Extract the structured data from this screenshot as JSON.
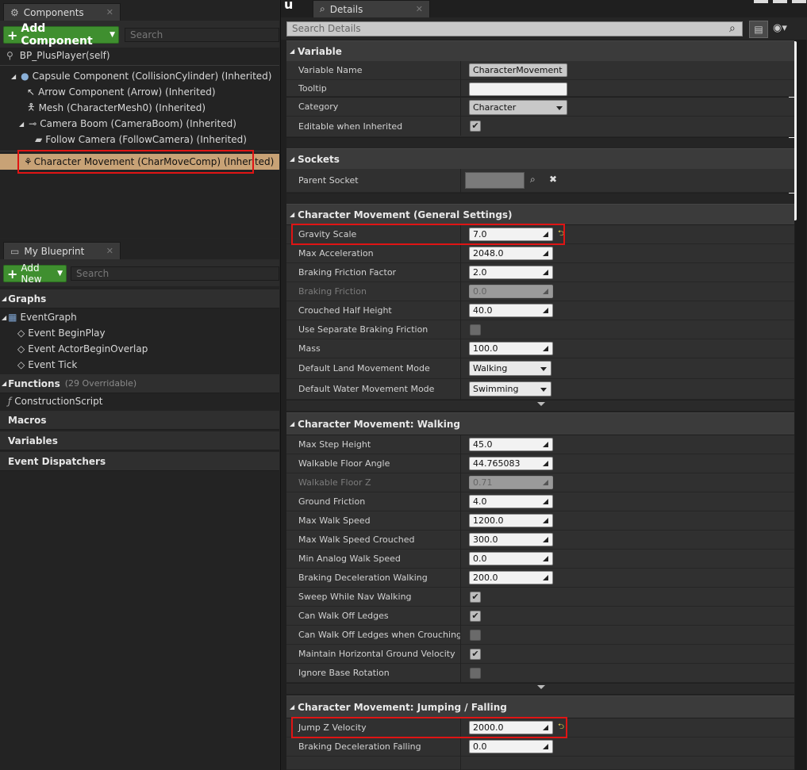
{
  "components": {
    "tab_label": "Components",
    "add_button": "Add Component",
    "search_placeholder": "Search",
    "self_label": "BP_PlusPlayer(self)",
    "tree": [
      {
        "label": "Capsule Component (CollisionCylinder) (Inherited)"
      },
      {
        "label": "Arrow Component (Arrow) (Inherited)"
      },
      {
        "label": "Mesh (CharacterMesh0) (Inherited)"
      },
      {
        "label": "Camera Boom (CameraBoom) (Inherited)"
      },
      {
        "label": "Follow Camera (FollowCamera) (Inherited)"
      }
    ],
    "selected": "Character Movement (CharMoveComp) (Inherited)"
  },
  "my_blueprint": {
    "tab_label": "My Blueprint",
    "add_button": "Add New",
    "search_placeholder": "Search",
    "graphs_label": "Graphs",
    "event_graph": "EventGraph",
    "events": [
      "Event BeginPlay",
      "Event ActorBeginOverlap",
      "Event Tick"
    ],
    "functions_label": "Functions",
    "functions_count": "(29 Overridable)",
    "construction_script": "ConstructionScript",
    "macros": "Macros",
    "variables": "Variables",
    "event_dispatchers": "Event Dispatchers"
  },
  "details": {
    "tab_label": "Details",
    "search_placeholder": "Search Details",
    "variable_section": "Variable",
    "variable_name_label": "Variable Name",
    "variable_name_value": "CharacterMovement",
    "tooltip_label": "Tooltip",
    "tooltip_value": "",
    "category_label": "Category",
    "category_value": "Character",
    "editable_label": "Editable when Inherited",
    "sockets_section": "Sockets",
    "parent_socket_label": "Parent Socket",
    "general_section": "Character Movement (General Settings)",
    "general": [
      {
        "label": "Gravity Scale",
        "value": "7.0"
      },
      {
        "label": "Max Acceleration",
        "value": "2048.0"
      },
      {
        "label": "Braking Friction Factor",
        "value": "2.0"
      },
      {
        "label": "Braking Friction",
        "value": "0.0"
      },
      {
        "label": "Crouched Half Height",
        "value": "40.0"
      },
      {
        "label": "Use Separate Braking Friction",
        "value": ""
      },
      {
        "label": "Mass",
        "value": "100.0"
      },
      {
        "label": "Default Land Movement Mode",
        "value": "Walking"
      },
      {
        "label": "Default Water Movement Mode",
        "value": "Swimming"
      }
    ],
    "walking_section": "Character Movement: Walking",
    "walking": [
      {
        "label": "Max Step Height",
        "value": "45.0"
      },
      {
        "label": "Walkable Floor Angle",
        "value": "44.765083"
      },
      {
        "label": "Walkable Floor Z",
        "value": "0.71"
      },
      {
        "label": "Ground Friction",
        "value": "4.0"
      },
      {
        "label": "Max Walk Speed",
        "value": "1200.0"
      },
      {
        "label": "Max Walk Speed Crouched",
        "value": "300.0"
      },
      {
        "label": "Min Analog Walk Speed",
        "value": "0.0"
      },
      {
        "label": "Braking Deceleration Walking",
        "value": "200.0"
      },
      {
        "label": "Sweep While Nav Walking",
        "value": ""
      },
      {
        "label": "Can Walk Off Ledges",
        "value": ""
      },
      {
        "label": "Can Walk Off Ledges when Crouching",
        "value": ""
      },
      {
        "label": "Maintain Horizontal Ground Velocity",
        "value": ""
      },
      {
        "label": "Ignore Base Rotation",
        "value": ""
      }
    ],
    "jumping_section": "Character Movement: Jumping / Falling",
    "jumping": [
      {
        "label": "Jump Z Velocity",
        "value": "2000.0"
      },
      {
        "label": "Braking Deceleration Falling",
        "value": "0.0"
      }
    ]
  },
  "colors": {
    "accent_green": "#3f8f2f",
    "selection": "#c8a276",
    "highlight_red": "#e01414"
  }
}
